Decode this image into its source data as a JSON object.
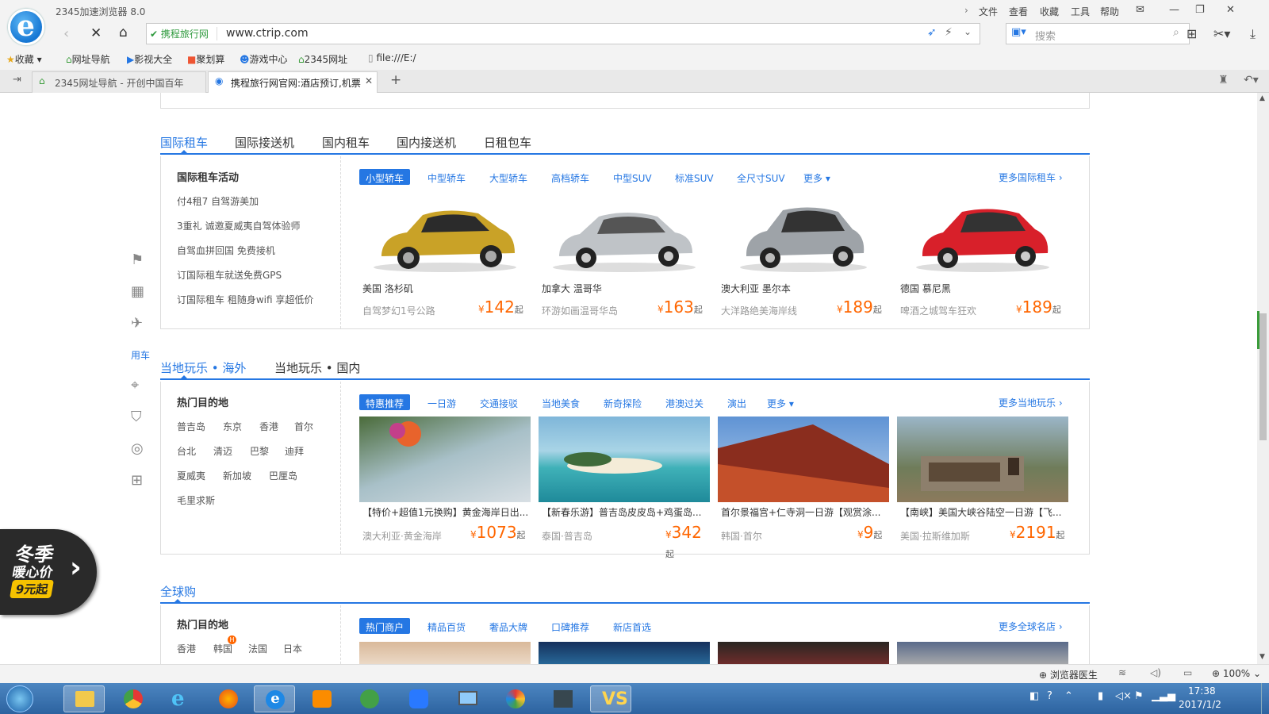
{
  "browser": {
    "app_title": "2345加速浏览器 8.0",
    "menus": [
      "文件",
      "查看",
      "收藏",
      "工具",
      "帮助"
    ],
    "secure_label": "携程旅行网",
    "url": "www.ctrip.com",
    "search_placeholder": "搜索",
    "favorites": [
      "收藏",
      "网址导航",
      "影视大全",
      "聚划算",
      "游戏中心",
      "2345网址",
      "file:///E:/"
    ],
    "tabs": [
      {
        "label": "2345网址导航 - 开创中国百年"
      },
      {
        "label": "携程旅行网官网:酒店预订,机票"
      }
    ]
  },
  "side_nav": {
    "active_label": "用车"
  },
  "car_section": {
    "tabs": [
      "国际租车",
      "国际接送机",
      "国内租车",
      "国内接送机",
      "日租包车"
    ],
    "left_title": "国际租车活动",
    "left_items": [
      "付4租7 自驾游美加",
      "3重礼 诚邀夏威夷自驾体验师",
      "自驾血拼回国 免费接机",
      "订国际租车就送免费GPS",
      "订国际租车 租随身wifi 享超低价"
    ],
    "filters": [
      "小型轿车",
      "中型轿车",
      "大型轿车",
      "高档轿车",
      "中型SUV",
      "标准SUV",
      "全尺寸SUV",
      "更多"
    ],
    "more_link": "更多国际租车",
    "cards": [
      {
        "location": "美国 洛杉矶",
        "subtitle": "自驾梦幻1号公路",
        "price": "142",
        "color": "#c9a227"
      },
      {
        "location": "加拿大 温哥华",
        "subtitle": "环游如画温哥华岛",
        "price": "163",
        "color": "#bfc3c7"
      },
      {
        "location": "澳大利亚 墨尔本",
        "subtitle": "大洋路绝美海岸线",
        "price": "189",
        "color": "#9ea3a8"
      },
      {
        "location": "德国 慕尼黑",
        "subtitle": "啤酒之城驾车狂欢",
        "price": "189",
        "color": "#d8202a"
      }
    ]
  },
  "fun_section": {
    "tabs": [
      "当地玩乐 • 海外",
      "当地玩乐 • 国内"
    ],
    "left_title": "热门目的地",
    "destinations": [
      "普吉岛",
      "东京",
      "香港",
      "首尔",
      "台北",
      "清迈",
      "巴黎",
      "迪拜",
      "夏威夷",
      "新加坡",
      "巴厘岛",
      "毛里求斯"
    ],
    "filters": [
      "特惠推荐",
      "一日游",
      "交通接驳",
      "当地美食",
      "新奇探险",
      "港澳过关",
      "演出",
      "更多"
    ],
    "more_link": "更多当地玩乐",
    "cards": [
      {
        "title": "【特价+超值1元换购】黄金海岸日出...",
        "subtitle": "澳大利亚·黄金海岸",
        "price": "1073"
      },
      {
        "title": "【新春乐游】普吉岛皮皮岛+鸡蛋岛...",
        "subtitle": "泰国·普吉岛",
        "price": "342"
      },
      {
        "title": "首尔景福宫+仁寺洞一日游【观赏涂...",
        "subtitle": "韩国·首尔",
        "price": "9"
      },
      {
        "title": "【南峡】美国大峡谷陆空一日游【飞...",
        "subtitle": "美国·拉斯维加斯",
        "price": "2191"
      }
    ]
  },
  "shop_section": {
    "tabs": [
      "全球购"
    ],
    "left_title": "热门目的地",
    "destinations": [
      "香港",
      "韩国",
      "法国",
      "日本"
    ],
    "hot_badge": "H",
    "filters": [
      "热门商户",
      "精品百货",
      "奢品大牌",
      "口碑推荐",
      "新店首选"
    ],
    "more_link": "更多全球名店"
  },
  "price_suffix": "起",
  "currency": "¥",
  "promo": {
    "line1": "冬季",
    "line2": "暖心价",
    "line3": "9元起"
  },
  "status_bar": {
    "doctor": "浏览器医生",
    "zoom": "100%"
  },
  "taskbar": {
    "time": "17:38",
    "date": "2017/1/2"
  }
}
